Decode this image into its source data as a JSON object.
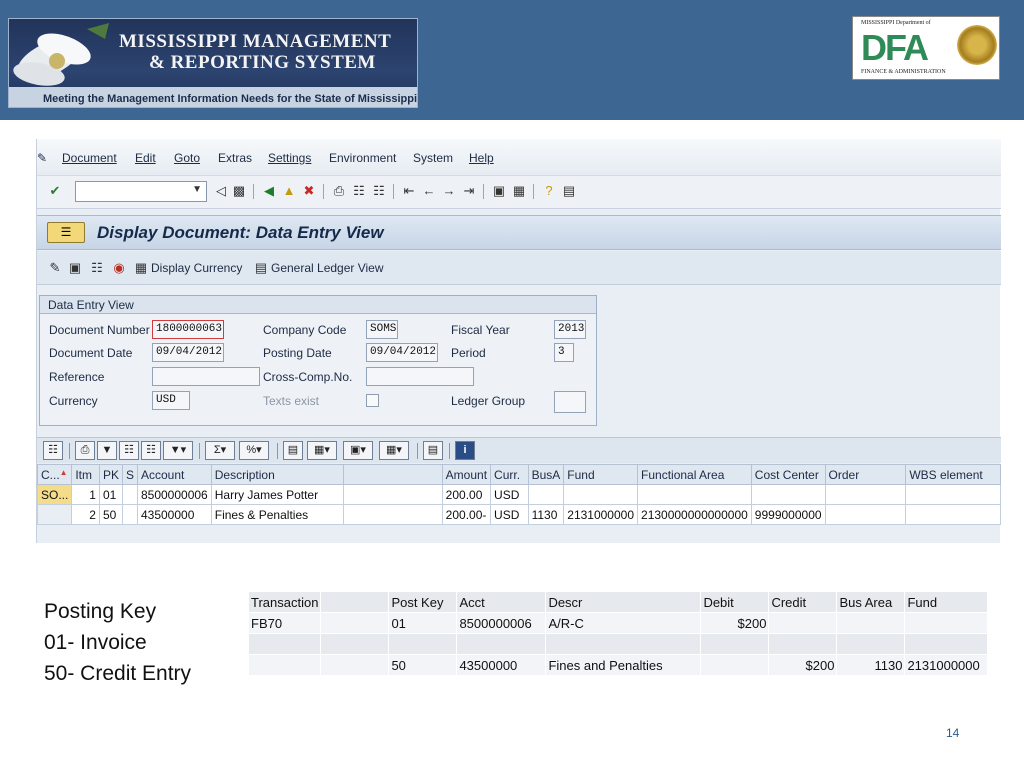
{
  "banner": {
    "line1": "MISSISSIPPI MANAGEMENT",
    "line2": "& REPORTING SYSTEM",
    "tagline": "Meeting the Management Information Needs for the State of Mississippi"
  },
  "dfa_logo": {
    "top": "MISSISSIPPI Department of",
    "letters": "DFA",
    "bottom": "FINANCE & ADMINISTRATION"
  },
  "sap": {
    "menu": [
      "Document",
      "Edit",
      "Goto",
      "Extras",
      "Settings",
      "Environment",
      "System",
      "Help"
    ],
    "command_field": "",
    "title": "Display Document: Data Entry View",
    "app_toolbar": {
      "display_currency": "Display Currency",
      "general_ledger_view": "General Ledger View"
    },
    "group": {
      "title": "Data Entry View",
      "document_number_label": "Document Number",
      "document_number": "1800000063",
      "company_code_label": "Company Code",
      "company_code": "SOMS",
      "fiscal_year_label": "Fiscal Year",
      "fiscal_year": "2013",
      "document_date_label": "Document Date",
      "document_date": "09/04/2012",
      "posting_date_label": "Posting Date",
      "posting_date": "09/04/2012",
      "period_label": "Period",
      "period": "3",
      "reference_label": "Reference",
      "reference": "",
      "cross_comp_label": "Cross-Comp.No.",
      "cross_comp": "",
      "currency_label": "Currency",
      "currency": "USD",
      "texts_exist_label": "Texts exist",
      "ledger_group_label": "Ledger Group",
      "ledger_group": ""
    },
    "grid": {
      "columns": [
        "C...",
        "Itm",
        "PK",
        "S",
        "Account",
        "Description",
        "",
        "Amount",
        "Curr.",
        "BusA",
        "Fund",
        "Functional Area",
        "Cost Center",
        "Order",
        "WBS element"
      ],
      "rows": [
        [
          "SO...",
          "1",
          "01",
          "",
          "8500000006",
          "Harry James Potter",
          "",
          "200.00",
          "USD",
          "",
          "",
          "",
          "",
          "",
          ""
        ],
        [
          "",
          "2",
          "50",
          "",
          "43500000",
          "Fines & Penalties",
          "",
          "200.00-",
          "USD",
          "1130",
          "2131000000",
          "2130000000000000",
          "9999000000",
          "",
          ""
        ]
      ]
    }
  },
  "notes": {
    "line1": "Posting Key",
    "line2": "01- Invoice",
    "line3": "50- Credit Entry"
  },
  "journal": {
    "headers": [
      "Transaction",
      "",
      "Post Key",
      "Acct",
      "Descr",
      "Debit",
      "Credit",
      "Bus Area",
      "Fund"
    ],
    "rows": [
      [
        "FB70",
        "",
        "01",
        "8500000006",
        "A/R-C",
        "$200",
        "",
        "",
        ""
      ],
      [
        "",
        "",
        "",
        "",
        "",
        "",
        "",
        "",
        ""
      ],
      [
        "",
        "",
        "50",
        "43500000",
        "Fines and Penalties",
        "",
        "$200",
        "1130",
        "2131000000"
      ]
    ]
  },
  "page_number": "14"
}
